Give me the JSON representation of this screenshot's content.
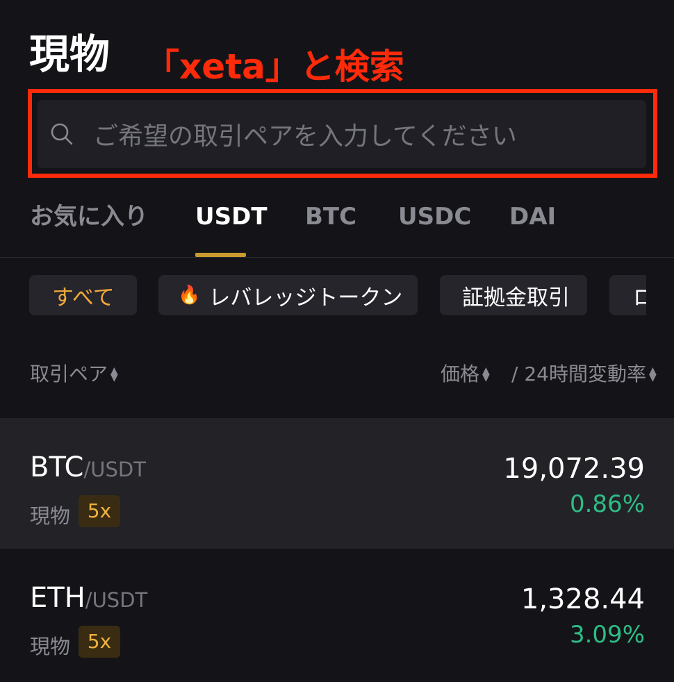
{
  "header": {
    "title": "現物",
    "annotation": "「xeta」と検索"
  },
  "search": {
    "placeholder": "ご希望の取引ペアを入力してください"
  },
  "tabs": [
    {
      "label": "お気に入り"
    },
    {
      "label": "USDT"
    },
    {
      "label": "BTC"
    },
    {
      "label": "USDC"
    },
    {
      "label": "DAI"
    }
  ],
  "active_tab": "USDT",
  "filters": [
    {
      "label": "すべて"
    },
    {
      "label": "レバレッジトークン"
    },
    {
      "label": "証拠金取引"
    },
    {
      "label": "ロ"
    }
  ],
  "columns": {
    "pair": "取引ペア",
    "price": "価格",
    "change": "/ 24時間変動率"
  },
  "rows": [
    {
      "base": "BTC",
      "quote": "/USDT",
      "type": "現物",
      "leverage": "5x",
      "price": "19,072.39",
      "change": "0.86%"
    },
    {
      "base": "ETH",
      "quote": "/USDT",
      "type": "現物",
      "leverage": "5x",
      "price": "1,328.44",
      "change": "3.09%"
    }
  ],
  "colors": {
    "background": "#141418",
    "annotation_red": "#ff2a0a",
    "accent_gold": "#c99a2e",
    "positive_green": "#2ebd85"
  },
  "icons": [
    "search-icon",
    "fire-icon",
    "sort-icon"
  ]
}
